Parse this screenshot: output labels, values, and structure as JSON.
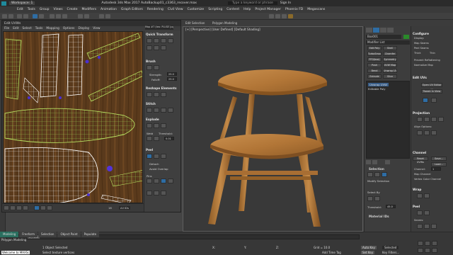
{
  "window": {
    "workspace": "Workspace: 1",
    "title": "Autodesk 3ds Max 2017    AutoBackup01_c3363_recover.max",
    "search_placeholder": "Type a keyword or phrase",
    "sign_in": "Sign In"
  },
  "menubar": {
    "items": [
      "Edit",
      "Tools",
      "Group",
      "Views",
      "Create",
      "Modifiers",
      "Animation",
      "Graph Editors",
      "Rendering",
      "Civil View",
      "Customize",
      "Scripting",
      "Content",
      "Help",
      "Project Manager",
      "Phoenix FD",
      "Megascans"
    ]
  },
  "ribbon": {
    "items": [
      "Edit Selection",
      "Polygon Modeling",
      "Freeform",
      "Selection",
      "Object Paint",
      "Populate"
    ]
  },
  "uv_editor": {
    "title": "Edit UVWs",
    "menu": [
      "File",
      "Edit",
      "Select",
      "Tools",
      "Mapping",
      "Options",
      "Display",
      "View"
    ],
    "map_dropdown": "Map #7 (teo: PLUGE jpg)",
    "texture_checkbox": "UV",
    "panel": {
      "quick_transform": "Quick Transform",
      "brush": "Brush",
      "strength_label": "Strength:",
      "strength_value": "25.0",
      "falloff_label": "Falloff:",
      "falloff_value": "25.0",
      "reshape_elements": "Reshape Elements",
      "stitch": "Stitch",
      "explode": "Explode",
      "weld": "Weld",
      "threshold_label": "Threshold:",
      "threshold_value": "0.01",
      "peel": "Peel",
      "detach": "Detach",
      "avoid_overlap": "Avoid Overlap",
      "pins": "Pins"
    },
    "bottom": {
      "zoom": "XY",
      "u_value": "0.0",
      "v_value": "0.0",
      "w_value": "0.0",
      "coord_readout": "16",
      "all_ids": "All IDs"
    }
  },
  "viewport": {
    "label": "[+] [Perspective] [User Defined] [Default Shading]"
  },
  "command_panel": {
    "object_name": "Box001",
    "modifier_list": "Modifier List",
    "modifier_buttons": [
      "Edit Poly",
      "Shell",
      "TurboSmooth",
      "Chamfer",
      "FFD(box)",
      "Symmetry",
      "Push",
      "UVW Map",
      "Bend",
      "Unwrap UVW",
      "Extrude",
      "Slice"
    ],
    "stack": [
      "Unwrap UVW",
      "Editable Poly"
    ],
    "selection": "Selection",
    "modify_selection": "Modify Selection",
    "select_by": "Select By",
    "threshold_label": "Threshold:",
    "threshold_value": "45.0",
    "material_ids": "Material IDs"
  },
  "right_panel": {
    "configure": "Configure",
    "display": "Display:",
    "map_seams": "Map Seams",
    "peel_seams": "Peel Seams",
    "thick": "Thick",
    "thin": "Thin",
    "prevent_reflattening": "Prevent Reflattening",
    "normalize_map": "Normalize Map",
    "edit_uvs": "Edit UVs",
    "open_uv_editor": "Open UV Editor ...",
    "tweak_in_view": "Tweak In View",
    "projection": "Projection",
    "align_options": "Align Options:",
    "channel": "Channel",
    "reset_uvws": "Reset UVWs",
    "save": "Save...",
    "load": "Load...",
    "channel_label": "Channel:",
    "channel_value": "1",
    "map_channel": "Map Channel",
    "vertex_color_channel": "Vertex Color Channel",
    "wrap": "Wrap",
    "peel": "Peel",
    "seams": "Seams:"
  },
  "status": {
    "tabs": [
      "Modeling",
      "Freeform",
      "Selection",
      "Object Paint",
      "Populate"
    ],
    "mode": "Polygon Modeling",
    "frame": "0 / 100",
    "selected": "1 Object Selected",
    "hint": "Select texture vertices",
    "x_label": "X:",
    "y_label": "Y:",
    "z_label": "Z:",
    "grid": "Grid = 10.0",
    "add_time_tag": "Add Time Tag",
    "autokey": "Auto Key",
    "selected_dd": "Selected",
    "setkey": "Set Key",
    "key_filters": "Key Filters...",
    "maxscript": "Welcome to MAXSc"
  }
}
